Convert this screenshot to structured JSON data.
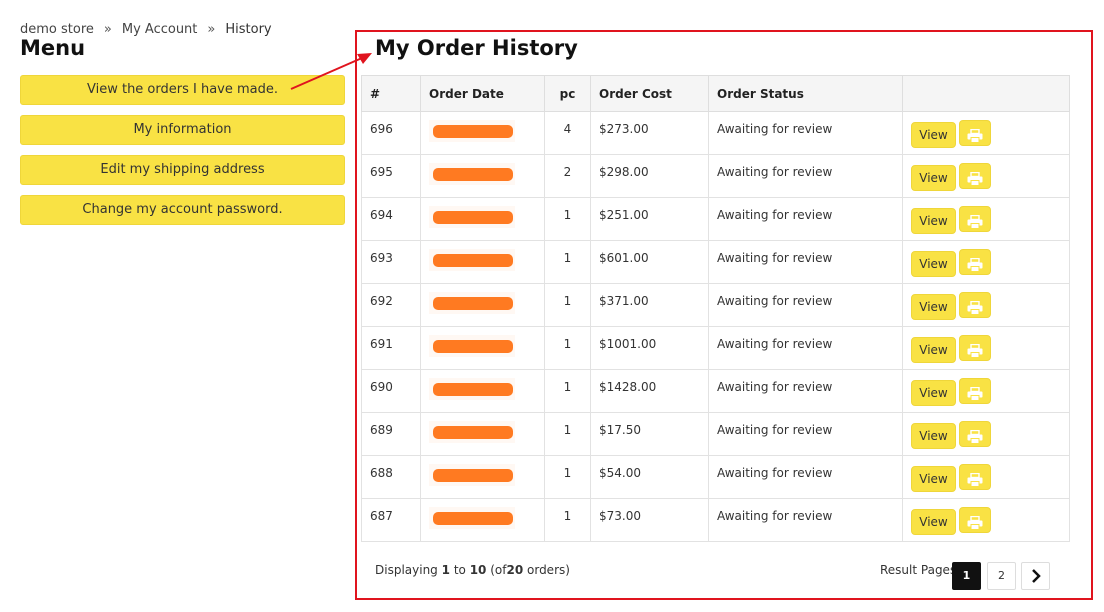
{
  "breadcrumb": {
    "items": [
      "demo store",
      "My Account",
      "History"
    ],
    "separator": "»"
  },
  "menu": {
    "title": "Menu",
    "items": [
      "View the orders I have made.",
      "My information",
      "Edit my shipping address",
      "Change my account password."
    ]
  },
  "history": {
    "title": "My Order History",
    "columns": [
      "#",
      "Order Date",
      "pc",
      "Order Cost",
      "Order Status"
    ],
    "view_label": "View",
    "print_icon": "printer-icon",
    "rows": [
      {
        "id": "696",
        "pc": "4",
        "cost": "$273.00",
        "status": "Awaiting for review"
      },
      {
        "id": "695",
        "pc": "2",
        "cost": "$298.00",
        "status": "Awaiting for review"
      },
      {
        "id": "694",
        "pc": "1",
        "cost": "$251.00",
        "status": "Awaiting for review"
      },
      {
        "id": "693",
        "pc": "1",
        "cost": "$601.00",
        "status": "Awaiting for review"
      },
      {
        "id": "692",
        "pc": "1",
        "cost": "$371.00",
        "status": "Awaiting for review"
      },
      {
        "id": "691",
        "pc": "1",
        "cost": "$1001.00",
        "status": "Awaiting for review"
      },
      {
        "id": "690",
        "pc": "1",
        "cost": "$1428.00",
        "status": "Awaiting for review"
      },
      {
        "id": "689",
        "pc": "1",
        "cost": "$17.50",
        "status": "Awaiting for review"
      },
      {
        "id": "688",
        "pc": "1",
        "cost": "$54.00",
        "status": "Awaiting for review"
      },
      {
        "id": "687",
        "pc": "1",
        "cost": "$73.00",
        "status": "Awaiting for review"
      }
    ]
  },
  "footer": {
    "displaying_prefix": "Displaying",
    "from": "1",
    "to_word": "to",
    "to": "10",
    "of_prefix": "(of",
    "total": "20",
    "of_suffix": "orders)",
    "result_pages_label": "Result Pages:",
    "pages": [
      "1",
      "2"
    ],
    "current_page": "1",
    "next_icon": "chevron-right-icon"
  },
  "colors": {
    "accent_yellow": "#f9e244",
    "highlight_red": "#e0141e",
    "redaction_orange": "#ff7a21"
  }
}
